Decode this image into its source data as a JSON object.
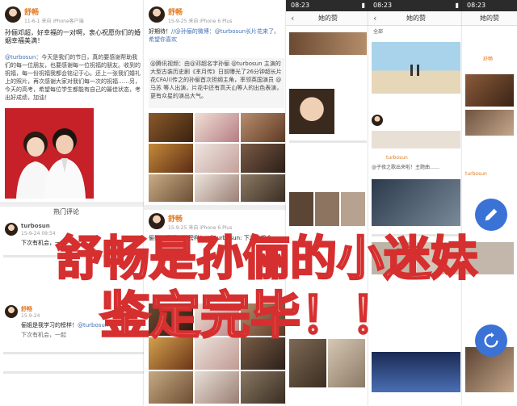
{
  "panel1": {
    "username": "舒畅",
    "meta": "11-6-1  来自 iPhone客户端",
    "post_text": "孙俪邓超，好幸福的一对啊，衷心祝愿你们的婚姻幸福美满！",
    "forward_prefix": "@turbosun",
    "forward_text": "：今天是我们的节日，真的要感谢帮助我们的每一位朋友，也要感谢每一位祝福的朋友。收到的祝福，每一份祝福我都会铭记于心。还上一张我们婚礼上的照片，再次感谢大家对我们每一次的祝福……另，今天的高考，希望每位学生都能有自己的最佳状态，考出好成绩，加油！",
    "hot_comments_label": "热门评论",
    "comment1_user": "turbosun",
    "comment1_meta": "15-9-24 09:54",
    "comment1_text": "下次有机会，一起",
    "comment2_user": "舒畅",
    "comment2_meta": "15-9-24",
    "comment2_text": "俪姐是我学习的榜样！",
    "comment2_mention": "@turbosun",
    "comment2_reply": "下次有机会，一起"
  },
  "panel2": {
    "username": "舒畅",
    "meta": "15-9-25  来自 iPhone 6 Plus",
    "post_text": "好期待！",
    "mention_block": "//@孙俪的微博：@turbosun长片花来了。希望你喜欢",
    "forward_block": "@腾讯视频：由@邓超名字孙俪 @turbosun 主演的大型古装历史剧《芈月传》日前曝光了26分钟超长片花CFA川传之的孙俪首次担纲主角，率领英国演员 @马苏 等人出演，片花中还有高天山等人的出色表演，更有众星的演出大气。",
    "username2": "舒畅",
    "meta2": "15-9-25  来自 iPhone 6 Plus",
    "post_text2": "俪姐是我学习的榜样！//@turbosun: 下次有机会"
  },
  "panel3": {
    "nav_title": "她的赞",
    "time": "08:23"
  },
  "panel4": {
    "nav_title": "她的赞",
    "tab": "全部",
    "card_user": "turbosun",
    "card_text": "@子夜之歌出来啦！主题曲……",
    "time": "08:23"
  },
  "panel5": {
    "nav_title": "她的赞",
    "time": "08:23",
    "user1": "舒畅",
    "user2": "turbosun"
  },
  "overlay": {
    "line1": "舒畅是孙俪的小迷妹",
    "line2": "鉴定完毕！！"
  },
  "colors": {
    "overlay_fill": "#f3d3d3",
    "overlay_stroke": "#d62f2f",
    "fab_compose": "#3a72d6",
    "fab_refresh": "#3a72d6",
    "weibo_orange": "#e07a1f",
    "link_blue": "#3f6fb5"
  },
  "icons": {
    "compose": "pencil-icon",
    "refresh": "refresh-icon",
    "back": "chevron-left-icon"
  }
}
